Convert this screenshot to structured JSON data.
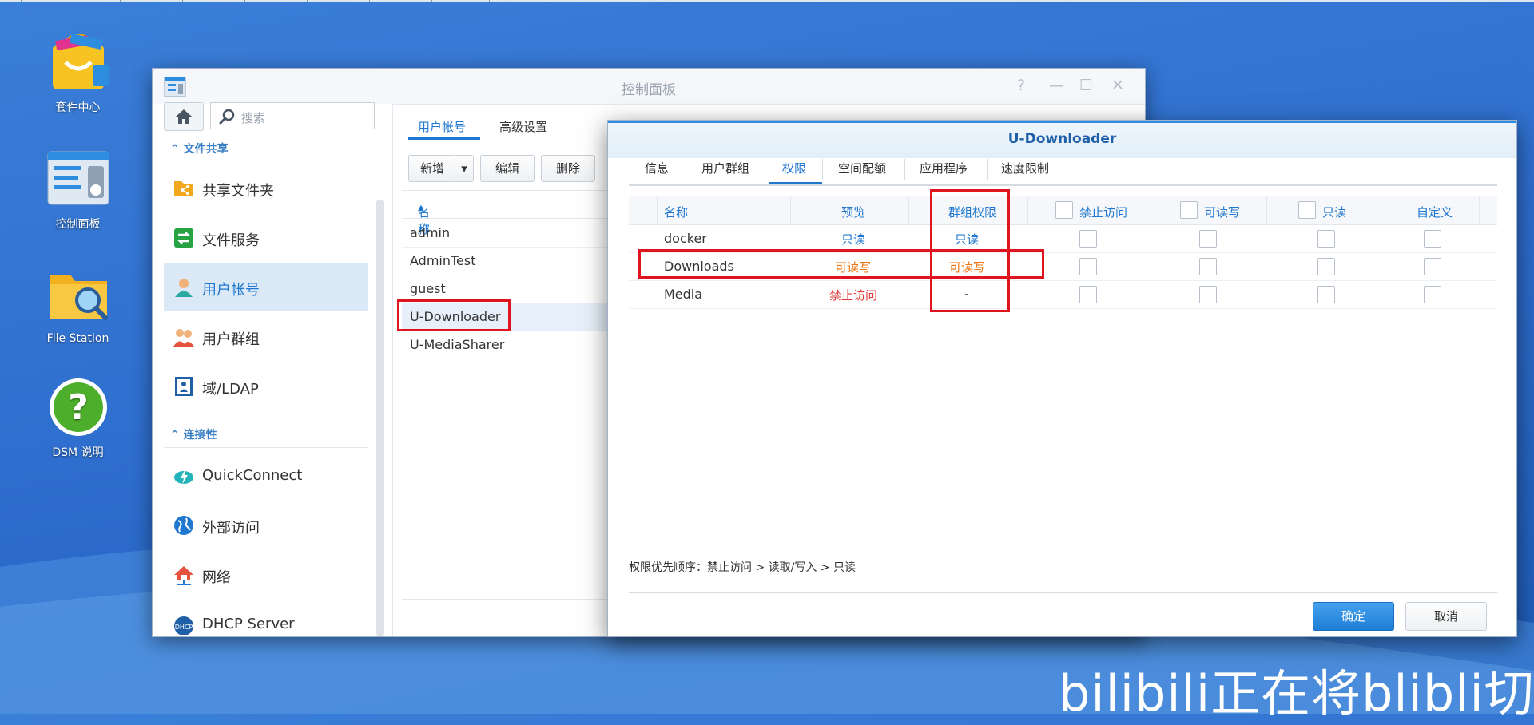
{
  "desktop": {
    "icons": [
      {
        "label": "套件中心",
        "icon": "package-center-icon"
      },
      {
        "label": "控制面板",
        "icon": "control-panel-icon"
      },
      {
        "label": "File Station",
        "icon": "file-station-icon"
      },
      {
        "label": "DSM 说明",
        "icon": "help-icon"
      }
    ],
    "watermark": "bilibili正在将blibli切片"
  },
  "control_panel": {
    "title": "控制面板",
    "search_placeholder": "搜索",
    "sections": [
      {
        "label": "文件共享"
      },
      {
        "label": "连接性"
      }
    ],
    "nav_items": [
      {
        "label": "共享文件夹",
        "icon": "shared-folder-icon"
      },
      {
        "label": "文件服务",
        "icon": "file-services-icon"
      },
      {
        "label": "用户帐号",
        "icon": "user-icon",
        "selected": true
      },
      {
        "label": "用户群组",
        "icon": "group-icon"
      },
      {
        "label": "域/LDAP",
        "icon": "ldap-icon"
      },
      {
        "label": "QuickConnect",
        "icon": "quickconnect-icon"
      },
      {
        "label": "外部访问",
        "icon": "globe-icon"
      },
      {
        "label": "网络",
        "icon": "network-icon"
      },
      {
        "label": "DHCP Server",
        "icon": "dhcp-icon"
      }
    ],
    "tabs": [
      {
        "label": "用户帐号",
        "active": true
      },
      {
        "label": "高级设置"
      }
    ],
    "toolbar": {
      "add": "新增",
      "edit": "编辑",
      "delete": "删除"
    },
    "list_header": "名称",
    "users": [
      "admin",
      "AdminTest",
      "guest",
      "U-Downloader",
      "U-MediaSharer"
    ],
    "selected_user": "U-Downloader"
  },
  "dialog": {
    "title": "U-Downloader",
    "tabs": [
      "信息",
      "用户群组",
      "权限",
      "空间配额",
      "应用程序",
      "速度限制"
    ],
    "active_tab": "权限",
    "columns": [
      "名称",
      "预览",
      "群组权限",
      "禁止访问",
      "可读写",
      "只读",
      "自定义"
    ],
    "rows": [
      {
        "name": "docker",
        "preview": "只读",
        "group": "只读",
        "preview_color": "#1f77d0",
        "group_color": "#1f77d0"
      },
      {
        "name": "Downloads",
        "preview": "可读写",
        "group": "可读写",
        "preview_color": "#f0720a",
        "group_color": "#f0720a"
      },
      {
        "name": "Media",
        "preview": "禁止访问",
        "group": "-",
        "preview_color": "#e23a3a",
        "group_color": "#333333"
      }
    ],
    "footnote": "权限优先顺序：禁止访问 > 读取/写入 > 只读",
    "ok": "确定",
    "cancel": "取消"
  },
  "colors": {
    "accent": "#1f77d0",
    "highlight_box": "#e0141e"
  }
}
